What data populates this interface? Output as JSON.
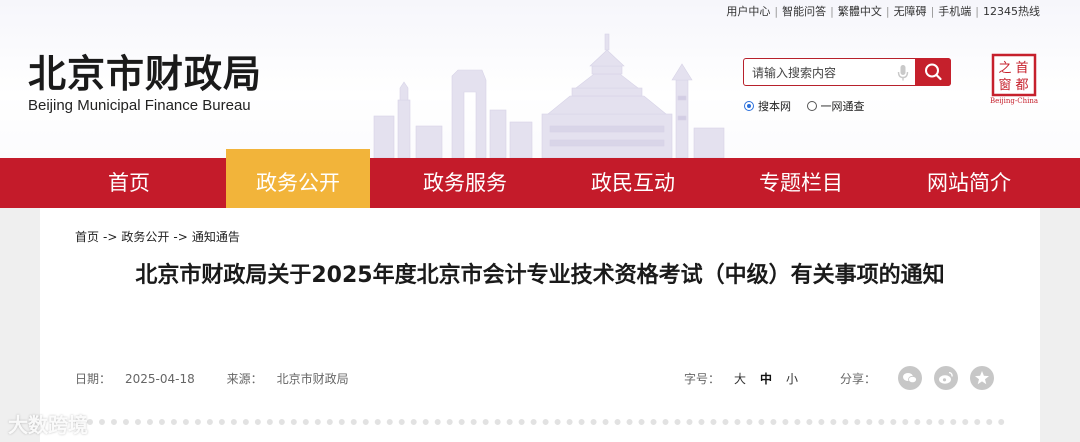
{
  "top_links": [
    "用户中心",
    "智能问答",
    "繁體中文",
    "无障碍",
    "手机端",
    "12345热线"
  ],
  "logo": {
    "cn": "北京市财政局",
    "en": "Beijing Municipal Finance Bureau"
  },
  "search": {
    "placeholder": "请输入搜索内容"
  },
  "search_scope": {
    "site": "搜本网",
    "network": "一网通查"
  },
  "seal": {
    "line1": "首都",
    "line2": "之窗",
    "en": "Beijing-China"
  },
  "nav": [
    "首页",
    "政务公开",
    "政务服务",
    "政民互动",
    "专题栏目",
    "网站简介"
  ],
  "nav_active": "政务公开",
  "breadcrumb": [
    "首页",
    "政务公开",
    "通知通告"
  ],
  "breadcrumb_sep": "->",
  "article": {
    "title": "北京市财政局关于2025年度北京市会计专业技术资格考试（中级）有关事项的通知",
    "date_label": "日期：",
    "date": "2025-04-18",
    "source_label": "来源：",
    "source": "北京市财政局"
  },
  "font_size": {
    "label": "字号：",
    "large": "大",
    "medium": "中",
    "small": "小"
  },
  "share": {
    "label": "分享："
  },
  "watermark": "大数跨境",
  "colors": {
    "nav_red": "#c41b2a",
    "nav_active": "#f2b43a",
    "search_button": "#c5202c"
  }
}
